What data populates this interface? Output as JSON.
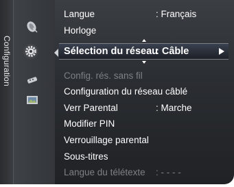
{
  "panel": {
    "title": "Configuration"
  },
  "categories": [
    {
      "icon": "satellite-dish-icon",
      "selected": false
    },
    {
      "icon": "gear-icon",
      "selected": true
    },
    {
      "icon": "remote-control-icon",
      "selected": false
    },
    {
      "icon": "picture-frame-icon",
      "selected": false
    }
  ],
  "menu": {
    "items": [
      {
        "label": "Langue",
        "value": ": Français",
        "state": "normal"
      },
      {
        "label": "Horloge",
        "value": "",
        "state": "normal"
      },
      {
        "label": "Sélection du réseau",
        "value": ": Câble",
        "state": "selected"
      },
      {
        "label": "Config. rés. sans fil",
        "value": "",
        "state": "disabled"
      },
      {
        "label": "Configuration du réseau câblé",
        "value": "",
        "state": "normal"
      },
      {
        "label": "Verr Parental",
        "value": ": Marche",
        "state": "normal"
      },
      {
        "label": "Modifier PIN",
        "value": "",
        "state": "normal"
      },
      {
        "label": "Verrouillage parental",
        "value": "",
        "state": "normal"
      },
      {
        "label": "Sous-titres",
        "value": "",
        "state": "normal"
      },
      {
        "label": "Langue du télétexte",
        "value": ": - - - -",
        "state": "disabled"
      }
    ]
  },
  "colors": {
    "text": "#ffffff",
    "text_disabled": "#7d8186",
    "background": "#2a2d31"
  }
}
